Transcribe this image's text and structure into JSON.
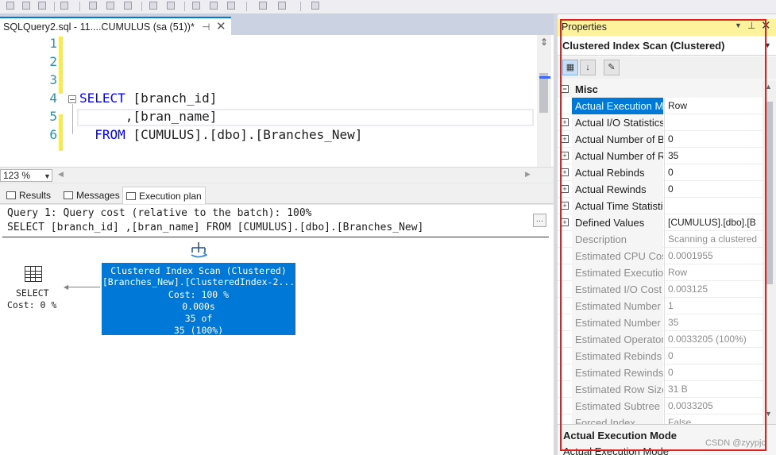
{
  "document_tab": {
    "title": "SQLQuery2.sql - 11....CUMULUS (sa (51))*",
    "pin_glyph": "⊣",
    "close_glyph": "✕"
  },
  "editor": {
    "line_numbers": [
      "1",
      "2",
      "3",
      "4",
      "5",
      "6"
    ],
    "lines": {
      "l4_keyword": "SELECT",
      "l4_rest": " [branch_id]",
      "l5": "      ,[bran_name]",
      "l6_keyword": "FROM",
      "l6_rest": " [CUMULUS].[dbo].[Branches_New]"
    },
    "zoom": "123 %"
  },
  "result_tabs": [
    {
      "label": "Results"
    },
    {
      "label": "Messages"
    },
    {
      "label": "Execution plan"
    }
  ],
  "execution_plan": {
    "header_line1": "Query 1: Query cost (relative to the batch): 100%",
    "header_line2": "SELECT [branch_id] ,[bran_name] FROM [CUMULUS].[dbo].[Branches_New]",
    "select_node": {
      "label": "SELECT",
      "cost": "Cost: 0 %"
    },
    "scan_node": {
      "title": "Clustered Index Scan (Clustered)",
      "object": "[Branches_New].[ClusteredIndex-2...",
      "cost": "Cost: 100 %",
      "time": "0.000s",
      "rows": "35 of",
      "pct": "35 (100%)"
    }
  },
  "properties": {
    "title": "Properties",
    "selected_object": "Clustered Index Scan (Clustered)",
    "category": "Misc",
    "rows": [
      {
        "name": "Actual Execution Mode",
        "value": "Row",
        "expandable": false,
        "readonly": false,
        "selected": true
      },
      {
        "name": "Actual I/O Statistics",
        "value": "",
        "expandable": true,
        "readonly": false,
        "selected": false
      },
      {
        "name": "Actual Number of Batches",
        "value": "0",
        "expandable": true,
        "readonly": false,
        "selected": false
      },
      {
        "name": "Actual Number of Rows",
        "value": "35",
        "expandable": true,
        "readonly": false,
        "selected": false
      },
      {
        "name": "Actual Rebinds",
        "value": "0",
        "expandable": true,
        "readonly": false,
        "selected": false
      },
      {
        "name": "Actual Rewinds",
        "value": "0",
        "expandable": true,
        "readonly": false,
        "selected": false
      },
      {
        "name": "Actual Time Statistics",
        "value": "",
        "expandable": true,
        "readonly": false,
        "selected": false
      },
      {
        "name": "Defined Values",
        "value": "[CUMULUS].[dbo].[B",
        "expandable": true,
        "readonly": false,
        "selected": false
      },
      {
        "name": "Description",
        "value": "Scanning a clustered",
        "expandable": false,
        "readonly": true,
        "selected": false
      },
      {
        "name": "Estimated CPU Cost",
        "value": "0.0001955",
        "expandable": false,
        "readonly": true,
        "selected": false
      },
      {
        "name": "Estimated Execution Mode",
        "value": "Row",
        "expandable": false,
        "readonly": true,
        "selected": false
      },
      {
        "name": "Estimated I/O Cost",
        "value": "0.003125",
        "expandable": false,
        "readonly": true,
        "selected": false
      },
      {
        "name": "Estimated Number of Executions",
        "value": "1",
        "expandable": false,
        "readonly": true,
        "selected": false
      },
      {
        "name": "Estimated Number of Rows",
        "value": "35",
        "expandable": false,
        "readonly": true,
        "selected": false
      },
      {
        "name": "Estimated Operator Cost",
        "value": "0.0033205 (100%)",
        "expandable": false,
        "readonly": true,
        "selected": false
      },
      {
        "name": "Estimated Rebinds",
        "value": "0",
        "expandable": false,
        "readonly": true,
        "selected": false
      },
      {
        "name": "Estimated Rewinds",
        "value": "0",
        "expandable": false,
        "readonly": true,
        "selected": false
      },
      {
        "name": "Estimated Row Size",
        "value": "31 B",
        "expandable": false,
        "readonly": true,
        "selected": false
      },
      {
        "name": "Estimated Subtree Cost",
        "value": "0.0033205",
        "expandable": false,
        "readonly": true,
        "selected": false
      },
      {
        "name": "Forced Index",
        "value": "False",
        "expandable": false,
        "readonly": true,
        "selected": false
      }
    ],
    "description_title": "Actual Execution Mode",
    "description_text": "Actual Execution Mode",
    "watermark": "CSDN @zyypjc"
  },
  "colors": {
    "accent": "#0078d7",
    "highlight_frame": "#e0201c",
    "panel_title_bg": "#fff29d",
    "change_marker": "#f5e960"
  }
}
